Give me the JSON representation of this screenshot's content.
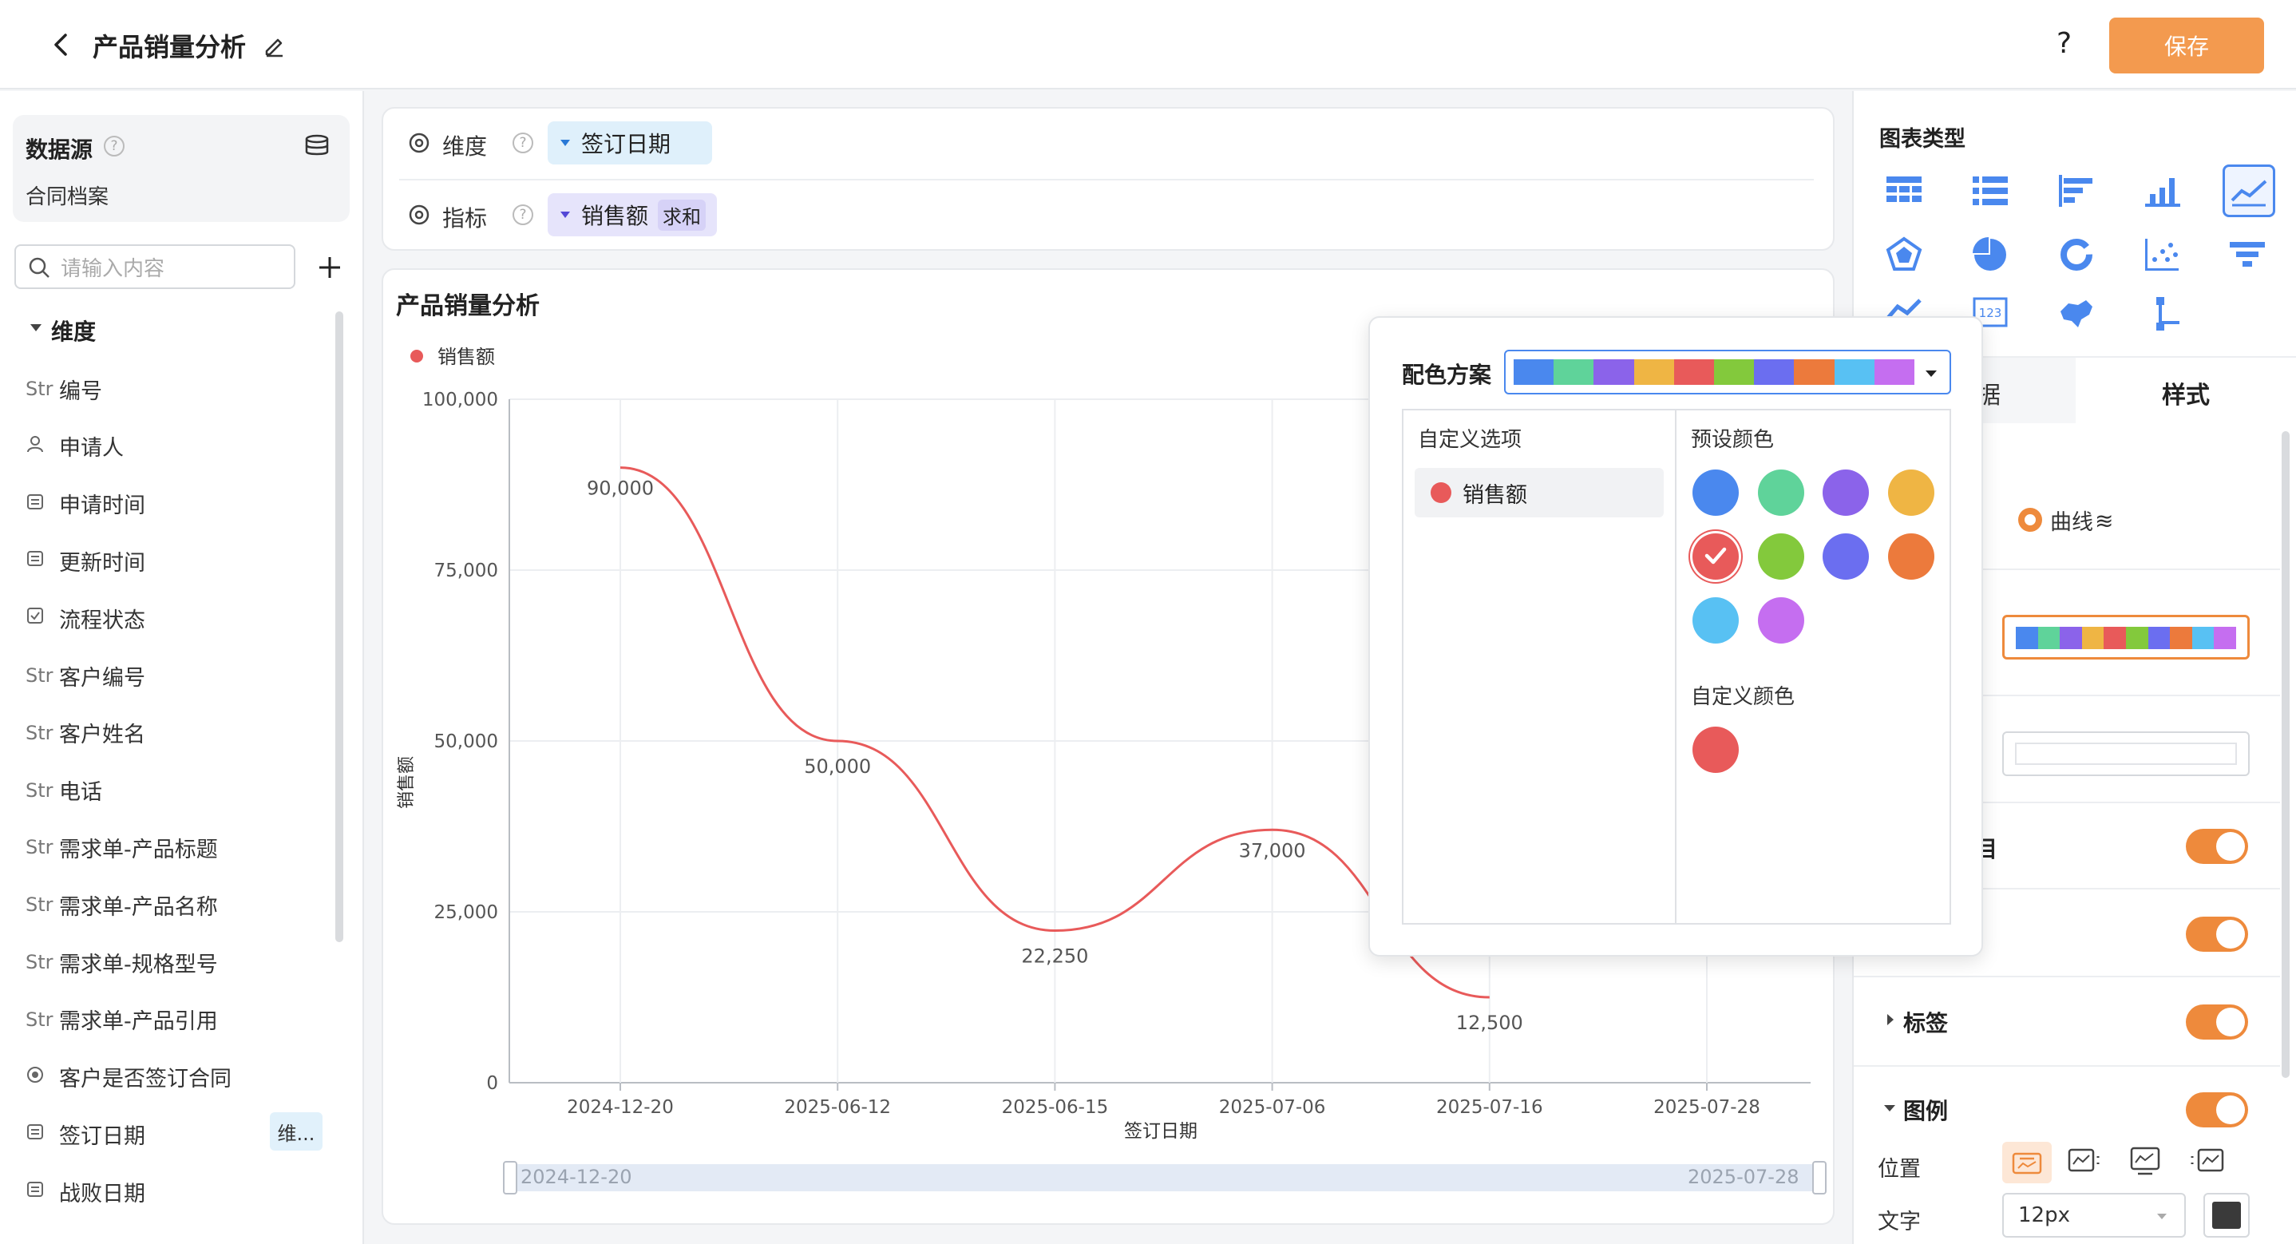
{
  "header": {
    "title": "产品销量分析",
    "help": "?",
    "save_label": "保存"
  },
  "sidebar": {
    "datasource_label": "数据源",
    "datasource_name": "合同档案",
    "search_placeholder": "请输入内容",
    "group_label": "维度",
    "fields": [
      {
        "type": "Str",
        "label": "编号"
      },
      {
        "type": "person",
        "label": "申请人"
      },
      {
        "type": "date",
        "label": "申请时间"
      },
      {
        "type": "date",
        "label": "更新时间"
      },
      {
        "type": "check",
        "label": "流程状态"
      },
      {
        "type": "Str",
        "label": "客户编号"
      },
      {
        "type": "Str",
        "label": "客户姓名"
      },
      {
        "type": "Str",
        "label": "电话"
      },
      {
        "type": "Str",
        "label": "需求单-产品标题"
      },
      {
        "type": "Str",
        "label": "需求单-产品名称"
      },
      {
        "type": "Str",
        "label": "需求单-规格型号"
      },
      {
        "type": "Str",
        "label": "需求单-产品引用"
      },
      {
        "type": "radio",
        "label": "客户是否签订合同"
      },
      {
        "type": "date",
        "label": "签订日期",
        "badge": "维..."
      },
      {
        "type": "date",
        "label": "战败日期"
      }
    ]
  },
  "config": {
    "dimension_label": "维度",
    "dimension_value": "签订日期",
    "metric_label": "指标",
    "metric_value": "销售额",
    "metric_agg": "求和"
  },
  "chart_card": {
    "title": "产品销量分析"
  },
  "chart_data": {
    "type": "line",
    "title": "产品销量分析",
    "legend": [
      "销售额"
    ],
    "legend_position": "top-left",
    "xlabel": "签订日期",
    "ylabel": "销售额",
    "ylim": [
      0,
      100000
    ],
    "yticks": [
      "0",
      "25,000",
      "50,000",
      "75,000",
      "100,000"
    ],
    "categories": [
      "2024-12-20",
      "2025-06-12",
      "2025-06-15",
      "2025-07-06",
      "2025-07-16",
      "2025-07-28"
    ],
    "series": [
      {
        "name": "销售额",
        "values": [
          90000,
          50000,
          22250,
          37000,
          12500,
          null
        ],
        "labels": [
          "90,000",
          "50,000",
          "22,250",
          "37,000",
          "12,500"
        ],
        "color": "#e85a5a",
        "smooth": true
      }
    ],
    "grid": true,
    "datazoom": {
      "start": "2024-12-20",
      "end": "2025-07-28"
    }
  },
  "color_popup": {
    "title": "配色方案",
    "custom_options_label": "自定义选项",
    "option_item": "销售额",
    "preset_label": "预设颜色",
    "custom_color_label": "自定义颜色",
    "palette": [
      "#4a88ee",
      "#5fd39a",
      "#8b63ea",
      "#efb544",
      "#e85a5a",
      "#83c93c",
      "#6b6ef0",
      "#ec7a3c",
      "#58c1f3",
      "#c56ef0"
    ],
    "selected": "#e85a5a",
    "custom_color": "#e85a5a"
  },
  "right_panel": {
    "chart_type_label": "图表类型",
    "tab_style": "样式",
    "tab_partial": "据",
    "curve_label": "曲线",
    "partial_toggle_label": "目",
    "label_section": "标签",
    "legend_section": "图例",
    "position_label": "位置",
    "text_label": "文字",
    "font_size": "12px",
    "text_color": "#3a3a3a"
  }
}
